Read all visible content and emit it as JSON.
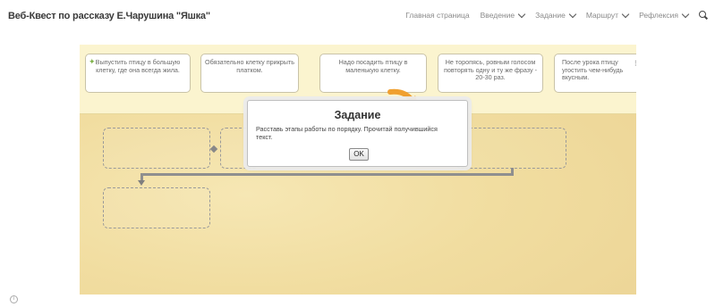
{
  "header": {
    "site_title": "Веб-Квест по рассказу Е.Чарушина \"Яшка\"",
    "nav": [
      {
        "label": "Главная страница",
        "has_dropdown": false
      },
      {
        "label": "Введение",
        "has_dropdown": true
      },
      {
        "label": "Задание",
        "has_dropdown": true
      },
      {
        "label": "Маршрут",
        "has_dropdown": true
      },
      {
        "label": "Рефлексия",
        "has_dropdown": true
      }
    ],
    "search_icon": "search-icon"
  },
  "game": {
    "cards": [
      {
        "text": "Выпустить птицу в большую клетку, где она всегда жила."
      },
      {
        "text": "Обязательно клетку прикрыть платком."
      },
      {
        "text": "Надо посадить птицу в маленькую клетку."
      },
      {
        "text": "Не торопясь, ровным голосом повторять одну и ту же фразу - 20-30 раз."
      },
      {
        "text": "После урока птицу угостить чем-нибудь вкусным."
      }
    ],
    "accent_color": "#f0a030"
  },
  "modal": {
    "title": "Задание",
    "text": "Расставь этапы работы по порядку. Прочитай получившийся текст.",
    "ok_label": "OK"
  },
  "footer": {
    "icon": "info-icon"
  }
}
